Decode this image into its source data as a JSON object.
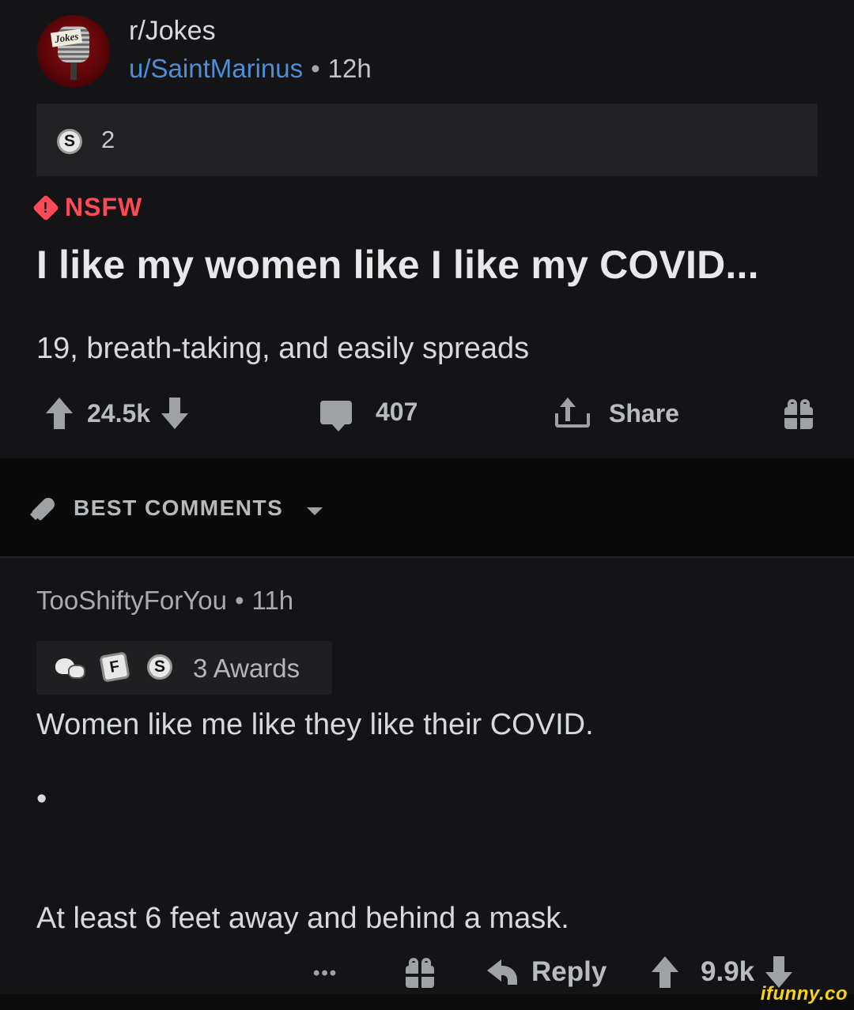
{
  "post": {
    "subreddit": "r/Jokes",
    "author": "u/SaintMarinus",
    "separator": "•",
    "age": "12h",
    "avatar_label": "Jokes",
    "award_coin": "S",
    "award_count": "2",
    "nsfw_label": "NSFW",
    "nsfw_glyph": "!",
    "title": "I like my women like I like my COVID...",
    "body": "19, breath-taking, and easily spreads",
    "upvotes": "24.5k",
    "comments": "407",
    "share_label": "Share"
  },
  "sort": {
    "label": "BEST COMMENTS"
  },
  "comment": {
    "author": "TooShiftyForYou",
    "separator": "•",
    "age": "11h",
    "award_key": "F",
    "award_coin": "S",
    "awards_label": "3 Awards",
    "line1": "Women like me like they like their COVID.",
    "line2": "•",
    "line3": "At least 6 feet away and behind a mask.",
    "more": "•••",
    "reply_label": "Reply",
    "score": "9.9k"
  },
  "watermark": "ifunny.co",
  "colors": {
    "background": "#141416",
    "username_link": "#4f8ed6",
    "nsfw": "#ff4a55",
    "watermark": "#f7d21b"
  }
}
